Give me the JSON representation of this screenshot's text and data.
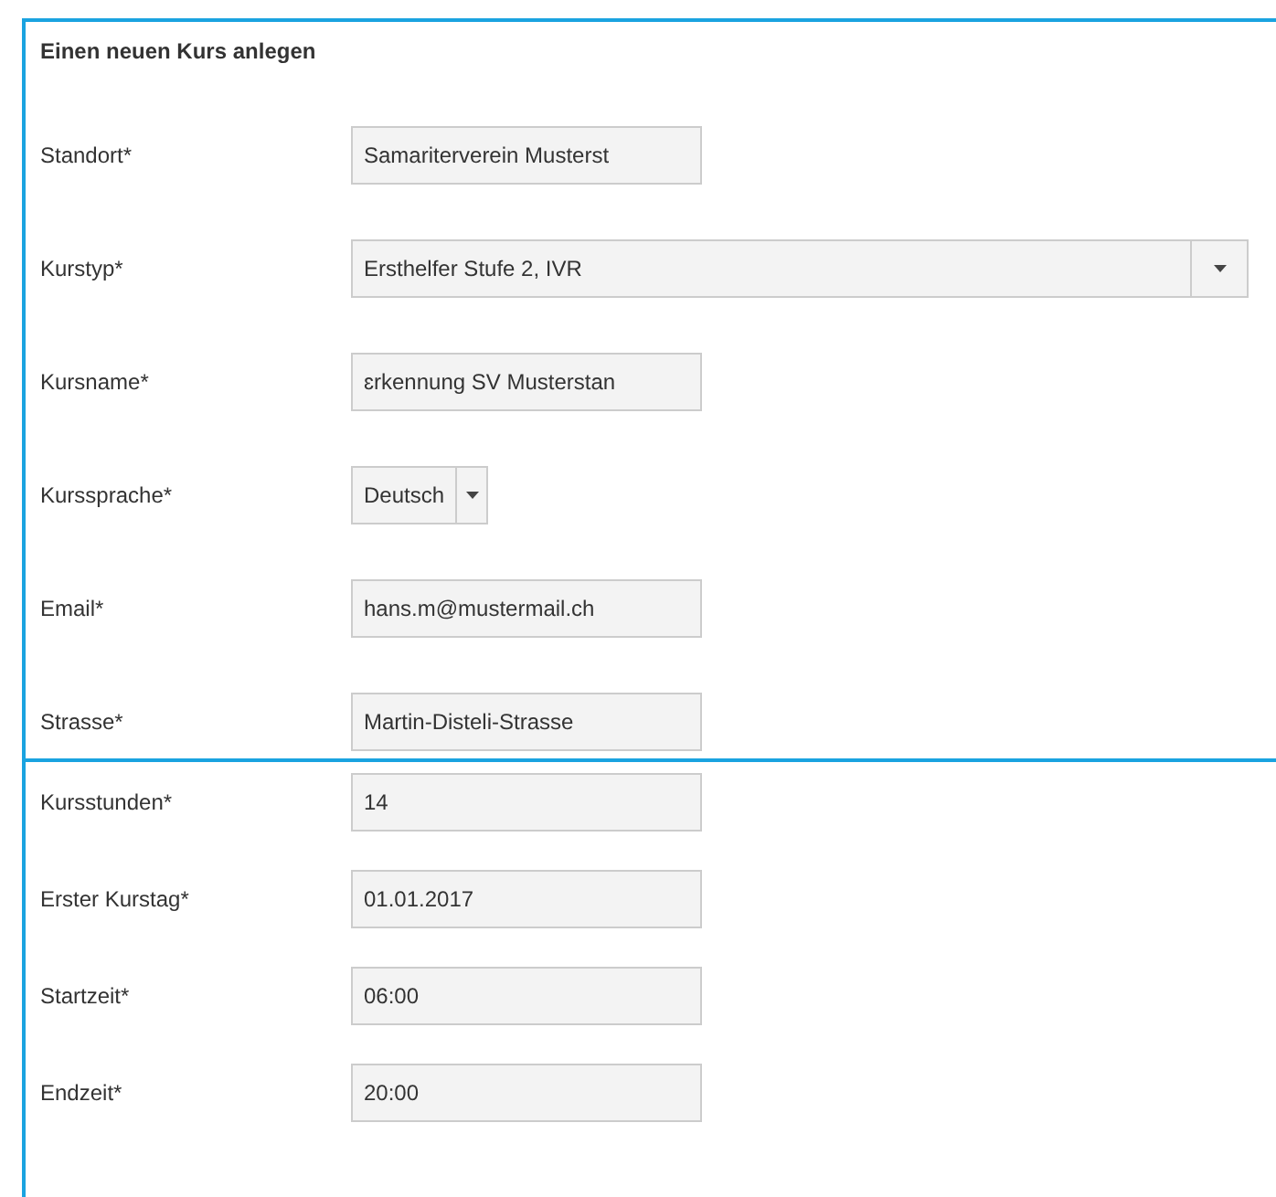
{
  "title": "Einen neuen Kurs anlegen",
  "sections": [
    {
      "fields": [
        {
          "label": "Standort*",
          "kind": "text",
          "value": "Samariterverein Musterst"
        },
        {
          "label": "Kurstyp*",
          "kind": "dropdown",
          "value": "Ersthelfer Stufe 2, IVR"
        },
        {
          "label": "Kursname*",
          "kind": "text",
          "value": "ɛrkennung SV Musterstan"
        },
        {
          "label": "Kurssprache*",
          "kind": "select",
          "value": "Deutsch"
        },
        {
          "label": "Email*",
          "kind": "text",
          "value": "hans.m@mustermail.ch"
        },
        {
          "label": "Strasse*",
          "kind": "text",
          "value": "Martin-Disteli-Strasse"
        }
      ]
    },
    {
      "fields": [
        {
          "label": "Kursstunden*",
          "kind": "text",
          "value": "14"
        },
        {
          "label": "Erster Kurstag*",
          "kind": "text",
          "value": "01.01.2017"
        },
        {
          "label": "Startzeit*",
          "kind": "text",
          "value": "06:00"
        },
        {
          "label": "Endzeit*",
          "kind": "text",
          "value": "20:00"
        }
      ]
    }
  ]
}
